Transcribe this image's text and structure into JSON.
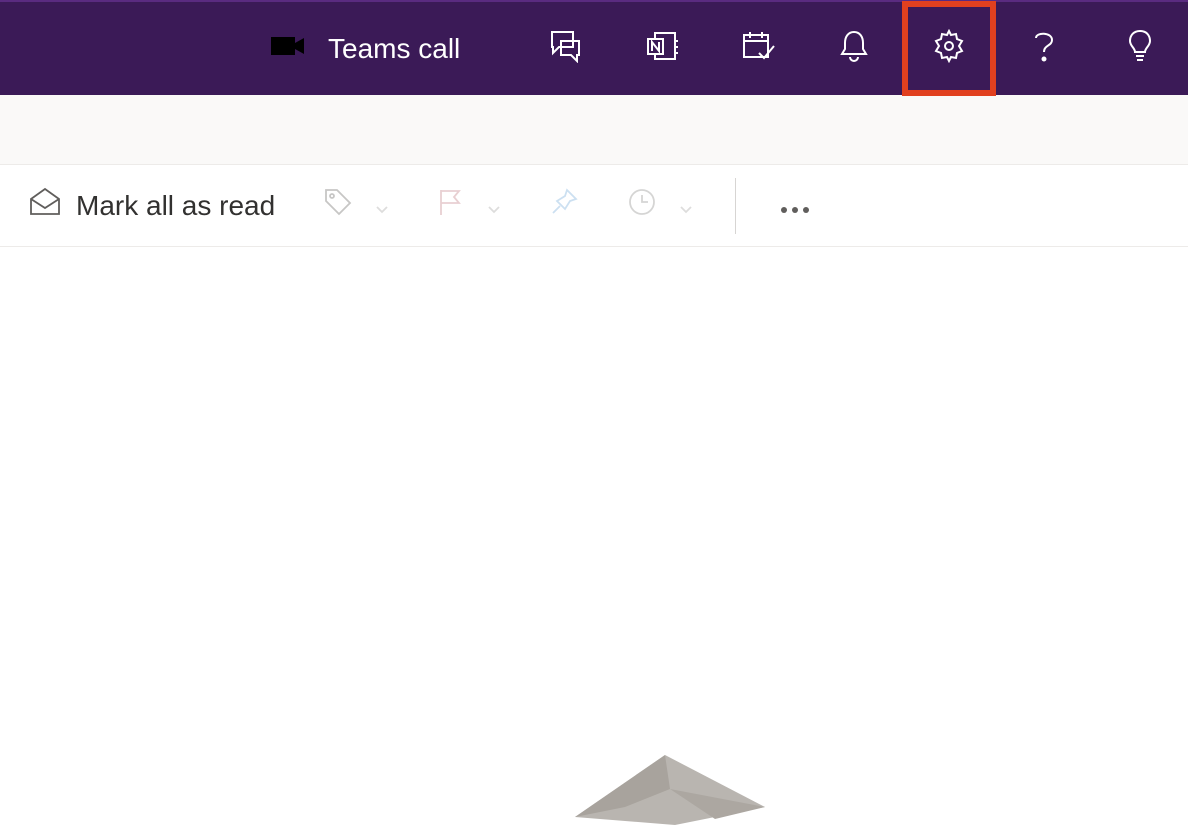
{
  "header": {
    "teams_call_label": "Teams call"
  },
  "toolbar": {
    "mark_all_read": "Mark all as read"
  }
}
